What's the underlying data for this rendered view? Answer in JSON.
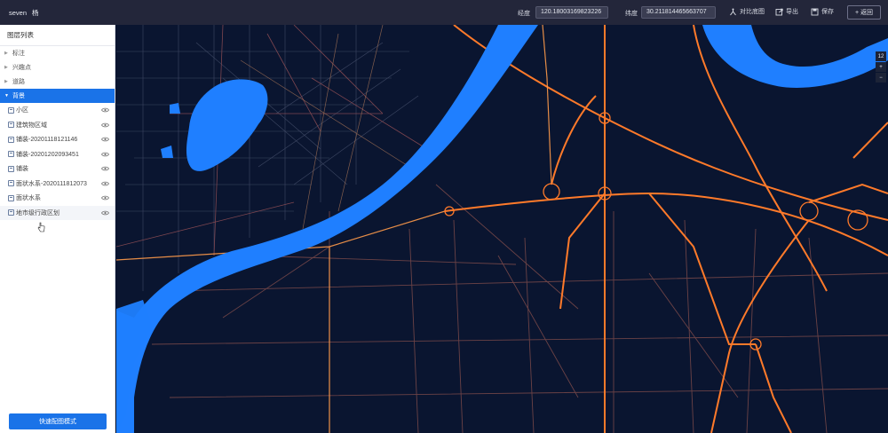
{
  "topbar": {
    "title": "seven",
    "title_extra": "杨",
    "longitude_label": "经度",
    "longitude_value": "120.18003169823226",
    "latitude_label": "纬度",
    "latitude_value": "30.211814465663707",
    "tools": [
      {
        "label": "对比底图",
        "icon": "compare-icon"
      },
      {
        "label": "导出",
        "icon": "export-icon"
      },
      {
        "label": "保存",
        "icon": "save-icon"
      }
    ],
    "back_label": "返回",
    "back_icon": "plus-icon"
  },
  "sidebar": {
    "header": "图层列表",
    "groups": [
      {
        "label": "标注",
        "state": "collapsed"
      },
      {
        "label": "兴趣点",
        "state": "collapsed"
      },
      {
        "label": "道路",
        "state": "collapsed"
      },
      {
        "label": "背景",
        "state": "expanded"
      }
    ],
    "layers": [
      {
        "label": "小区"
      },
      {
        "label": "建筑物区域"
      },
      {
        "label": "铺装-20201118121146"
      },
      {
        "label": "铺装-20201202093451"
      },
      {
        "label": "铺装"
      },
      {
        "label": "面状水系-2020111812073"
      },
      {
        "label": "面状水系"
      },
      {
        "label": "地市级行政区划"
      }
    ],
    "quick_button": "快速配图模式"
  },
  "map": {
    "zoom_level": "12",
    "zoom_in": "+",
    "zoom_out": "−",
    "colors": {
      "background": "#0a1530",
      "water": "#1f7fff",
      "highway": "#ff7a2a",
      "road": "#b45a52"
    }
  }
}
